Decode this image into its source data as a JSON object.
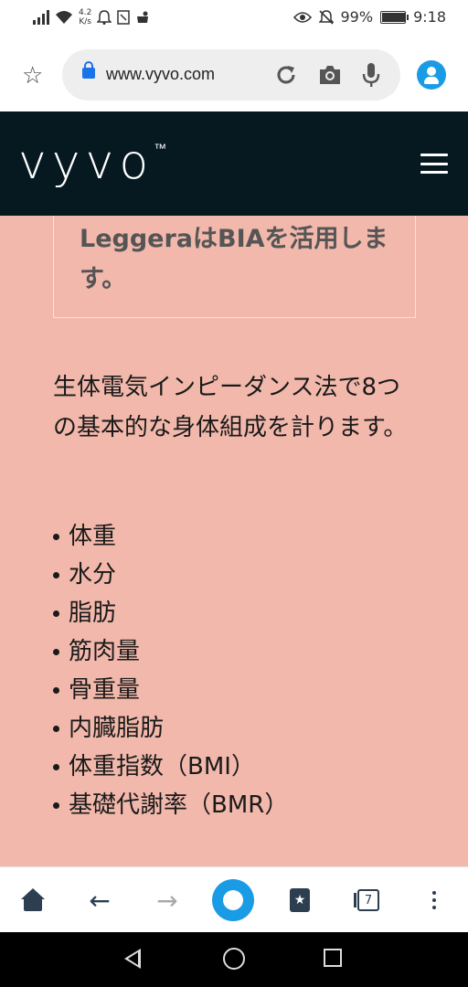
{
  "status_bar": {
    "network_speed_value": "4.2",
    "network_speed_unit": "K/s",
    "battery": "99%",
    "battery_level": 0.99,
    "time": "9:18"
  },
  "browser": {
    "url": "www.vyvo.com",
    "tab_count": "7"
  },
  "site": {
    "logo": "vyvo",
    "logo_mark": "™"
  },
  "content": {
    "boxed_text": "LeggeraはBIAを活用します。",
    "paragraph": "生体電気インピーダンス法で8つの基本的な身体組成を計ります。",
    "bullets": [
      "体重",
      "水分",
      "脂肪",
      "筋肉量",
      "骨重量",
      "内臓脂肪",
      "体重指数（BMI）",
      "基礎代謝率（BMR）"
    ]
  },
  "colors": {
    "header_bg": "#061820",
    "content_bg": "#f1b8ab",
    "accent": "#1a9be6"
  }
}
